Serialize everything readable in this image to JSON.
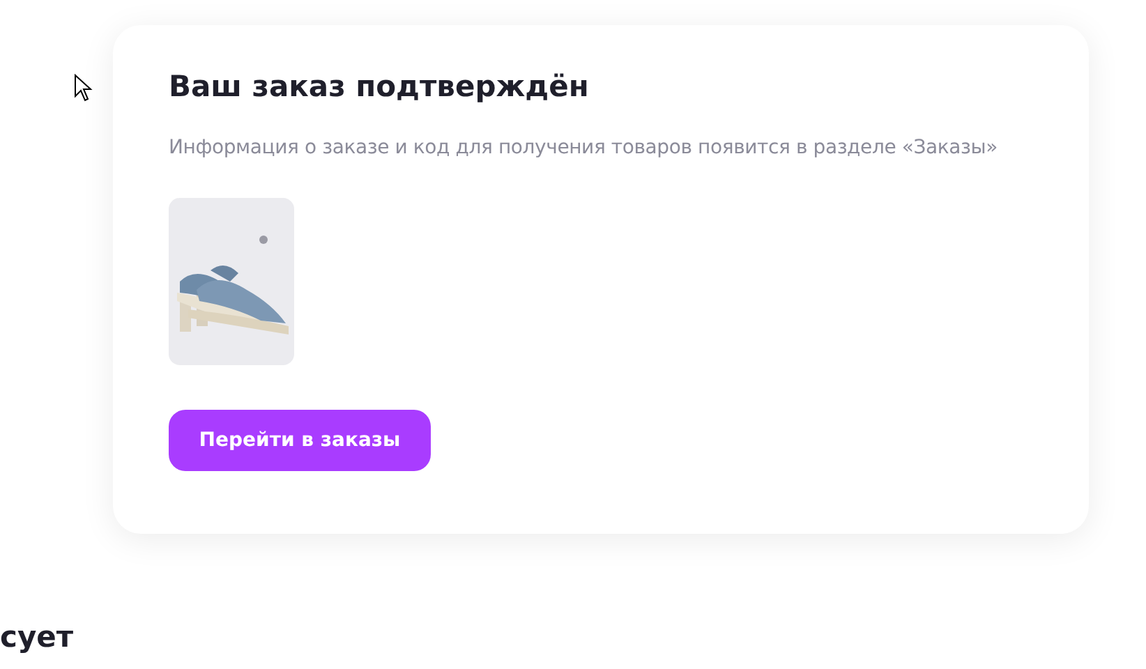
{
  "order_confirmation": {
    "title": "Ваш заказ подтверждён",
    "message": "Информация о заказе и код для получения товаров появится в разделе «Заказы»",
    "button": "Перейти в заказы"
  },
  "section_heading": "сует"
}
